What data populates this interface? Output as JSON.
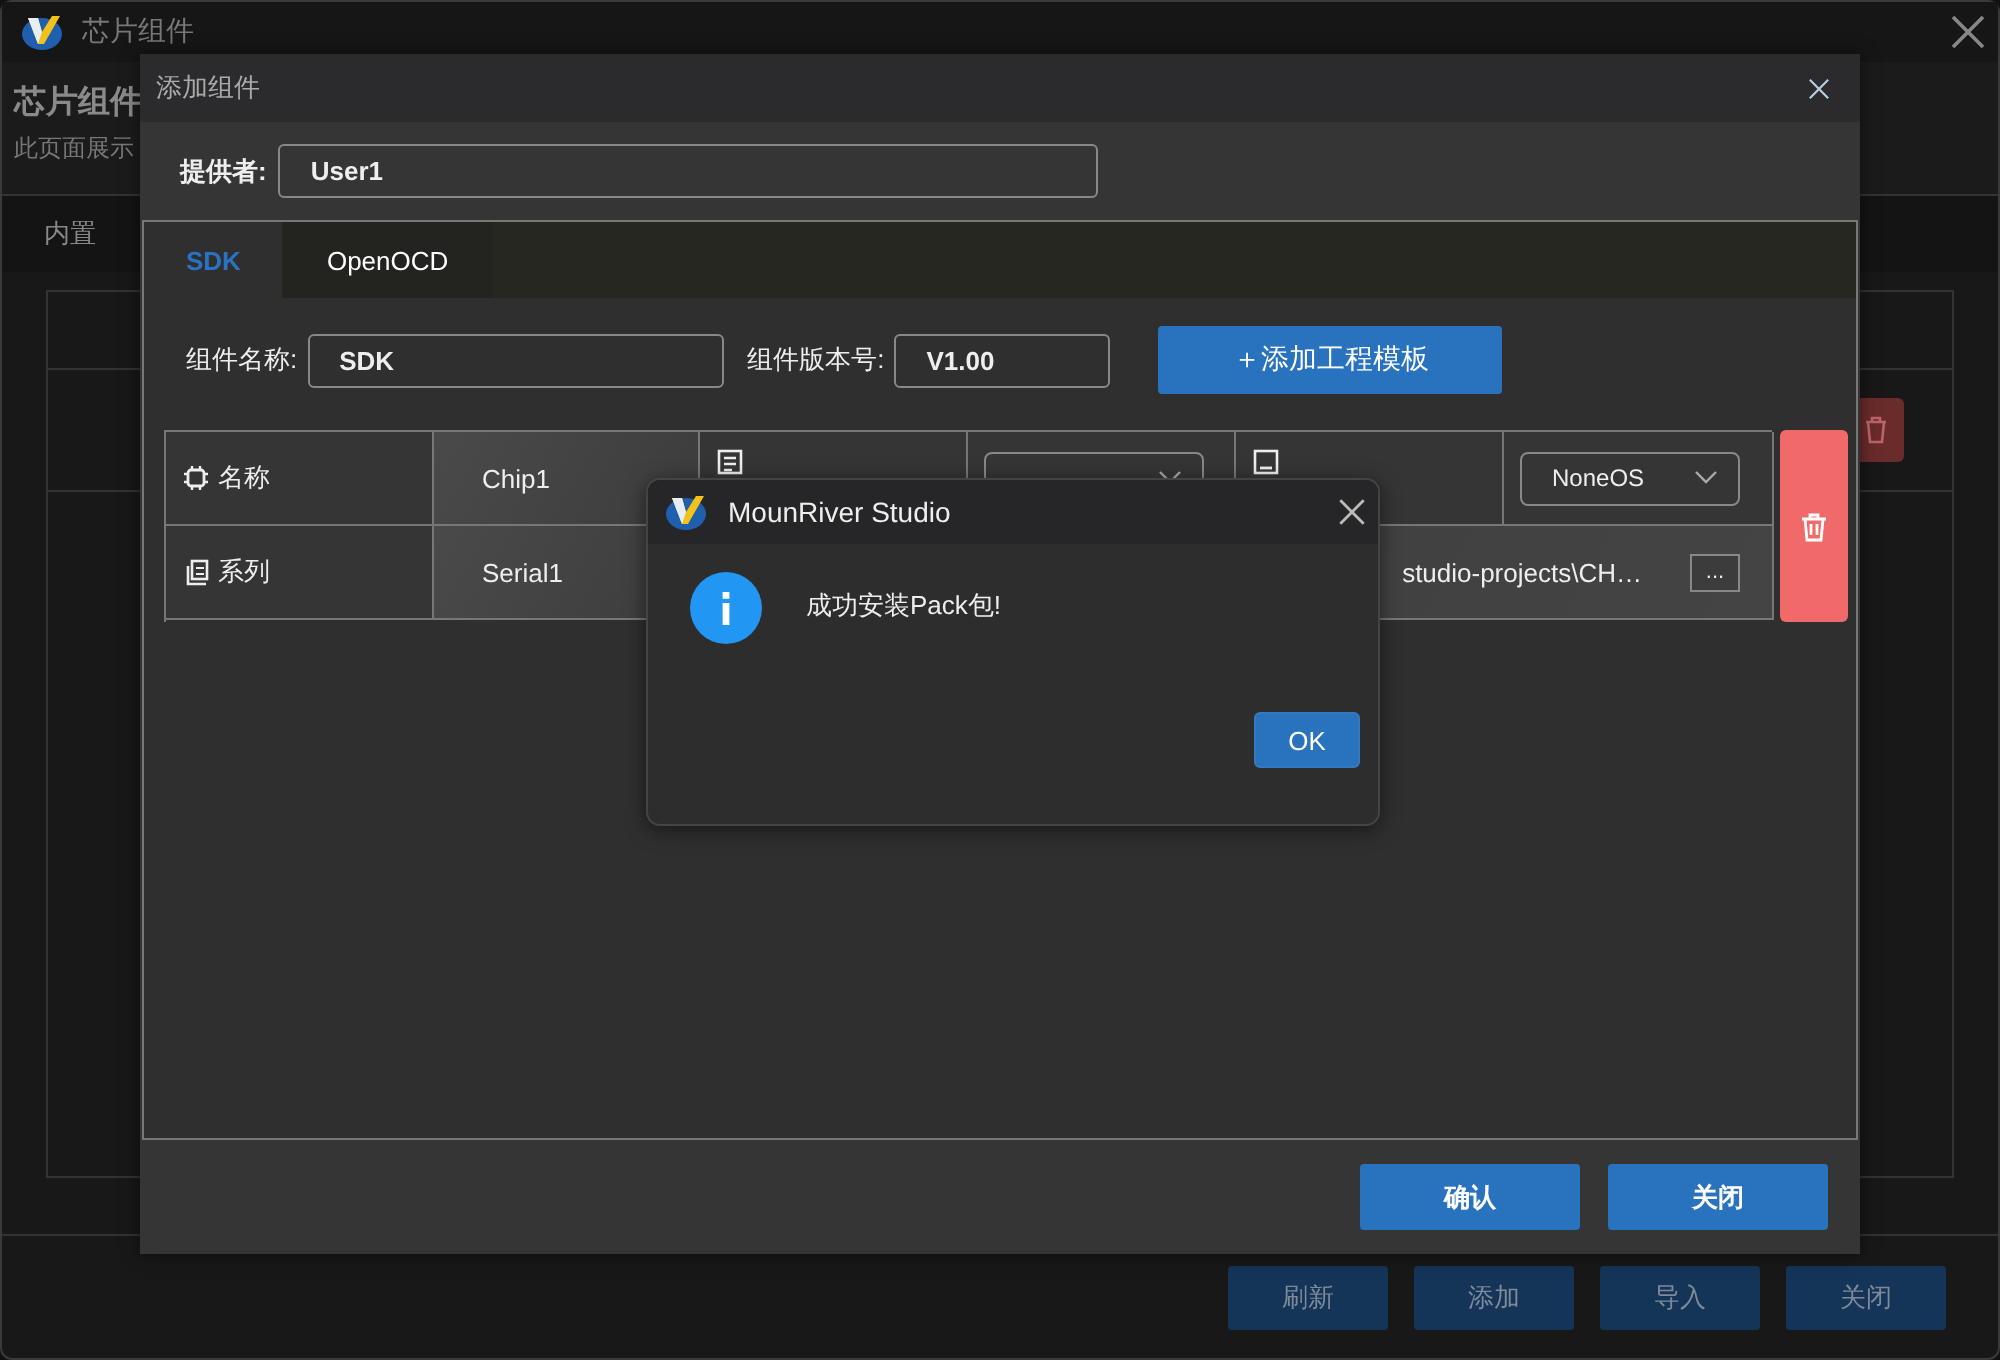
{
  "main_window": {
    "title": "芯片组件",
    "heading": "芯片组件",
    "description": "此页面展示",
    "tab_label": "内置",
    "table": {
      "rows": [
        {
          "deletable": true
        }
      ]
    },
    "buttons": [
      "刷新",
      "添加",
      "导入",
      "关闭"
    ]
  },
  "add_dialog": {
    "title": "添加组件",
    "provider_label": "提供者:",
    "provider": "User1",
    "tabs": [
      {
        "label": "SDK",
        "selected": true
      },
      {
        "label": "OpenOCD",
        "selected": false
      }
    ],
    "name_label": "组件名称:",
    "name": "SDK",
    "version_label": "组件版本号:",
    "version": "V1.00",
    "add_template_button": "＋添加工程模板",
    "chip_rows": [
      [
        {
          "kind": "label",
          "text": "名称"
        },
        {
          "kind": "value",
          "text": "Chip1"
        },
        {
          "kind": "label"
        },
        {
          "kind": "select"
        },
        {
          "kind": "label"
        },
        {
          "kind": "select",
          "text": "NoneOS"
        }
      ],
      [
        {
          "kind": "label",
          "text": "系列"
        },
        {
          "kind": "value",
          "text": "Serial1"
        },
        {
          "kind": "path",
          "text": "studio-projects\\CH…",
          "button": "..."
        }
      ]
    ],
    "buttons": [
      "确认",
      "关闭"
    ]
  },
  "message_box": {
    "title": "MounRiver Studio",
    "message": "成功安装Pack包!",
    "button": "OK"
  }
}
